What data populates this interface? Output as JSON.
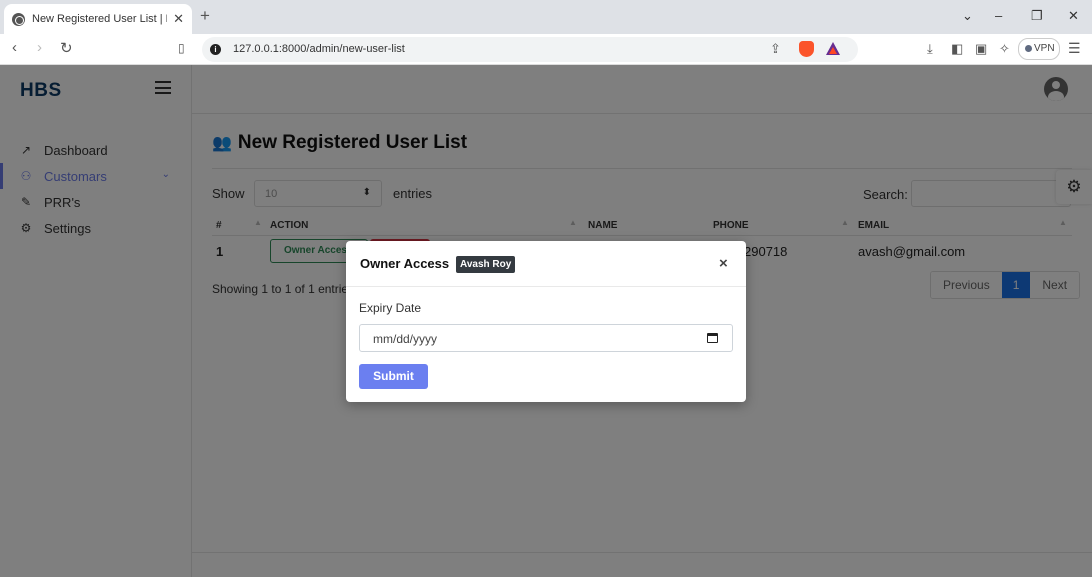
{
  "browser": {
    "tab_title": "New Registered User List | HBS",
    "tab_close": "✕",
    "new_tab": "+",
    "url": "127.0.0.1:8000/admin/new-user-list",
    "vpn_label": "VPN",
    "window_controls": [
      "⌄",
      "–",
      "❐",
      "✕"
    ]
  },
  "app": {
    "brand": "HBS",
    "nav": [
      {
        "label": "Dashboard",
        "icon": "trend-icon"
      },
      {
        "label": "Customars",
        "icon": "users-icon",
        "active": true
      },
      {
        "label": "PRR's",
        "icon": "edit-icon"
      },
      {
        "label": "Settings",
        "icon": "gear-icon"
      }
    ],
    "accent_color": "#6b7be8"
  },
  "page": {
    "title": "New Registered User List",
    "show_label": "Show",
    "entries_value": "10",
    "entries_label": "entries",
    "search_label": "Search:",
    "table": {
      "headers": [
        "#",
        "ACTION",
        "NAME",
        "PHONE",
        "EMAIL"
      ],
      "rows": [
        {
          "num": "1",
          "action_label": "Owner Access",
          "phone_partial": "290718",
          "email": "avash@gmail.com"
        }
      ]
    },
    "showing_text": "Showing 1 to 1 of 1 entries",
    "pagination": {
      "previous": "Previous",
      "current": "1",
      "next": "Next"
    }
  },
  "modal": {
    "title": "Owner Access",
    "badge": "Avash Roy",
    "close": "×",
    "field_label": "Expiry Date",
    "date_placeholder": "mm/dd/yyyy",
    "submit_label": "Submit",
    "submit_color": "#6b7ff0"
  }
}
